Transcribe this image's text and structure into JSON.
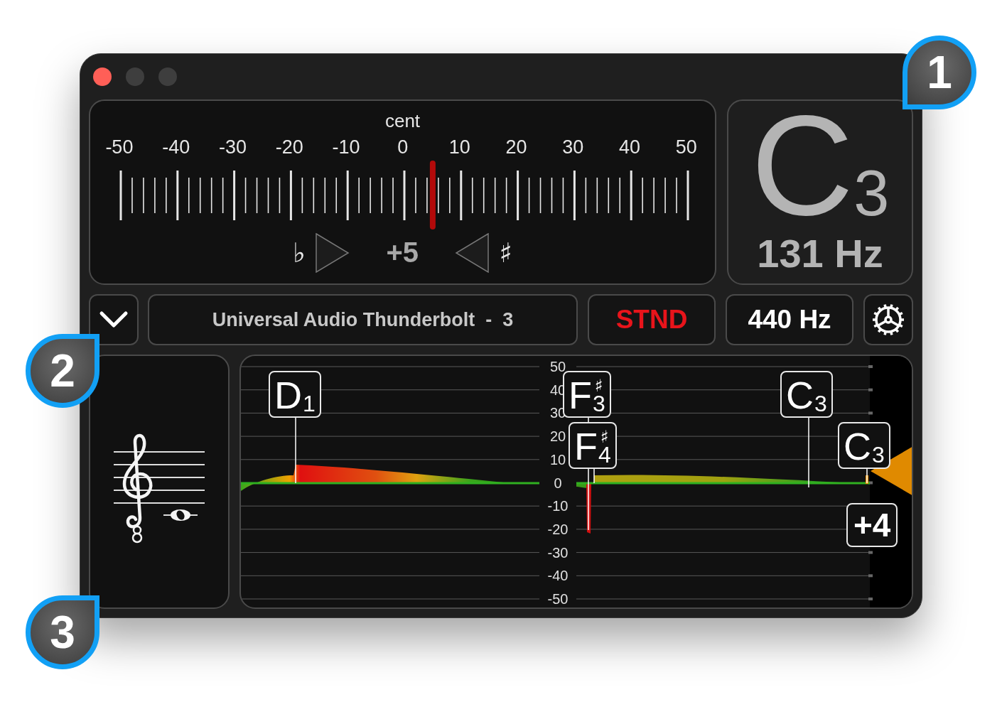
{
  "meter": {
    "title": "cent",
    "scale": [
      "-50",
      "-40",
      "-30",
      "-20",
      "-10",
      "0",
      "10",
      "20",
      "30",
      "40",
      "50"
    ],
    "level": 0.55,
    "flat_symbol": "♭",
    "sharp_symbol": "♯",
    "reading": "+5"
  },
  "note_display": {
    "note": "C",
    "octave": "3",
    "frequency": "131 Hz"
  },
  "toolbar": {
    "device": "Universal Audio Thunderbolt  -  3",
    "temperament": "STND",
    "reference": "440 Hz"
  },
  "history": {
    "axis_labels": [
      "50",
      "40",
      "30",
      "20",
      "10",
      "0",
      "-10",
      "-20",
      "-30",
      "-40",
      "-50"
    ],
    "markers": [
      {
        "note": "D",
        "octave": "1"
      },
      {
        "note": "F",
        "accidental": "♯",
        "octave": "3"
      },
      {
        "note": "F",
        "accidental": "♯",
        "octave": "4"
      },
      {
        "note": "C",
        "octave": "3"
      },
      {
        "note": "C",
        "octave": "3"
      }
    ],
    "deviation": "+4"
  },
  "callouts": [
    "1",
    "2",
    "3"
  ]
}
